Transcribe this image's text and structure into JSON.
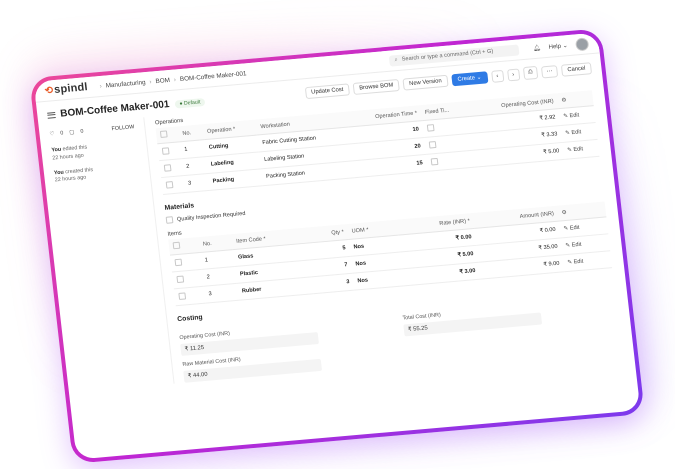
{
  "app": {
    "logo": "spindl"
  },
  "breadcrumb": [
    "Manufacturing",
    "BOM",
    "BOM-Coffee Maker-001"
  ],
  "search": {
    "placeholder": "Search or type a command (Ctrl + G)"
  },
  "topbar": {
    "help": "Help"
  },
  "page": {
    "title": "BOM-Coffee Maker-001",
    "status": "Default",
    "actions": {
      "update_cost": "Update Cost",
      "browse_bom": "Browse BOM",
      "new_version": "New Version",
      "create": "Create"
    },
    "cancel": "Cancel"
  },
  "sidebar": {
    "likes": "0",
    "comments": "0",
    "follow": "FOLLOW",
    "activity": [
      {
        "who": "You",
        "what": "edited this",
        "when": "22 hours ago"
      },
      {
        "who": "You",
        "what": "created this",
        "when": "22 hours ago"
      }
    ]
  },
  "operations": {
    "label": "Operations",
    "columns": [
      "No.",
      "Operation *",
      "Workstation",
      "Operation Time *",
      "Fixed Ti...",
      "Operating Cost (INR)"
    ],
    "rows": [
      {
        "no": "1",
        "operation": "Cutting",
        "workstation": "Fabric Cutting Station",
        "time": "10",
        "cost": "₹ 2.92",
        "edit": "Edit"
      },
      {
        "no": "2",
        "operation": "Labeling",
        "workstation": "Labeling Station",
        "time": "20",
        "cost": "₹ 3.33",
        "edit": "Edit"
      },
      {
        "no": "3",
        "operation": "Packing",
        "workstation": "Packing Station",
        "time": "15",
        "cost": "₹ 5.00",
        "edit": "Edit"
      }
    ]
  },
  "materials": {
    "title": "Materials",
    "quality_inspection": "Quality Inspection Required",
    "items_label": "Items",
    "columns": [
      "No.",
      "Item Code *",
      "Qty *",
      "UOM *",
      "Rate (INR) *",
      "Amount (INR)"
    ],
    "rows": [
      {
        "no": "1",
        "item": "Glass",
        "qty": "5",
        "uom": "Nos",
        "rate": "₹ 0.00",
        "amount": "₹ 0.00",
        "edit": "Edit"
      },
      {
        "no": "2",
        "item": "Plastic",
        "qty": "7",
        "uom": "Nos",
        "rate": "₹ 5.00",
        "amount": "₹ 35.00",
        "edit": "Edit"
      },
      {
        "no": "3",
        "item": "Rubber",
        "qty": "3",
        "uom": "Nos",
        "rate": "₹ 3.00",
        "amount": "₹ 9.00",
        "edit": "Edit"
      }
    ]
  },
  "costing": {
    "title": "Costing",
    "operating_cost_label": "Operating Cost (INR)",
    "operating_cost": "₹ 11.25",
    "raw_material_label": "Raw Material Cost (INR)",
    "raw_material": "₹ 44.00",
    "total_label": "Total Cost (INR)",
    "total": "₹ 55.25"
  },
  "colors": {
    "frame_start": "#ec4899",
    "frame_end": "#7c3aed",
    "primary": "#2f7be5"
  }
}
